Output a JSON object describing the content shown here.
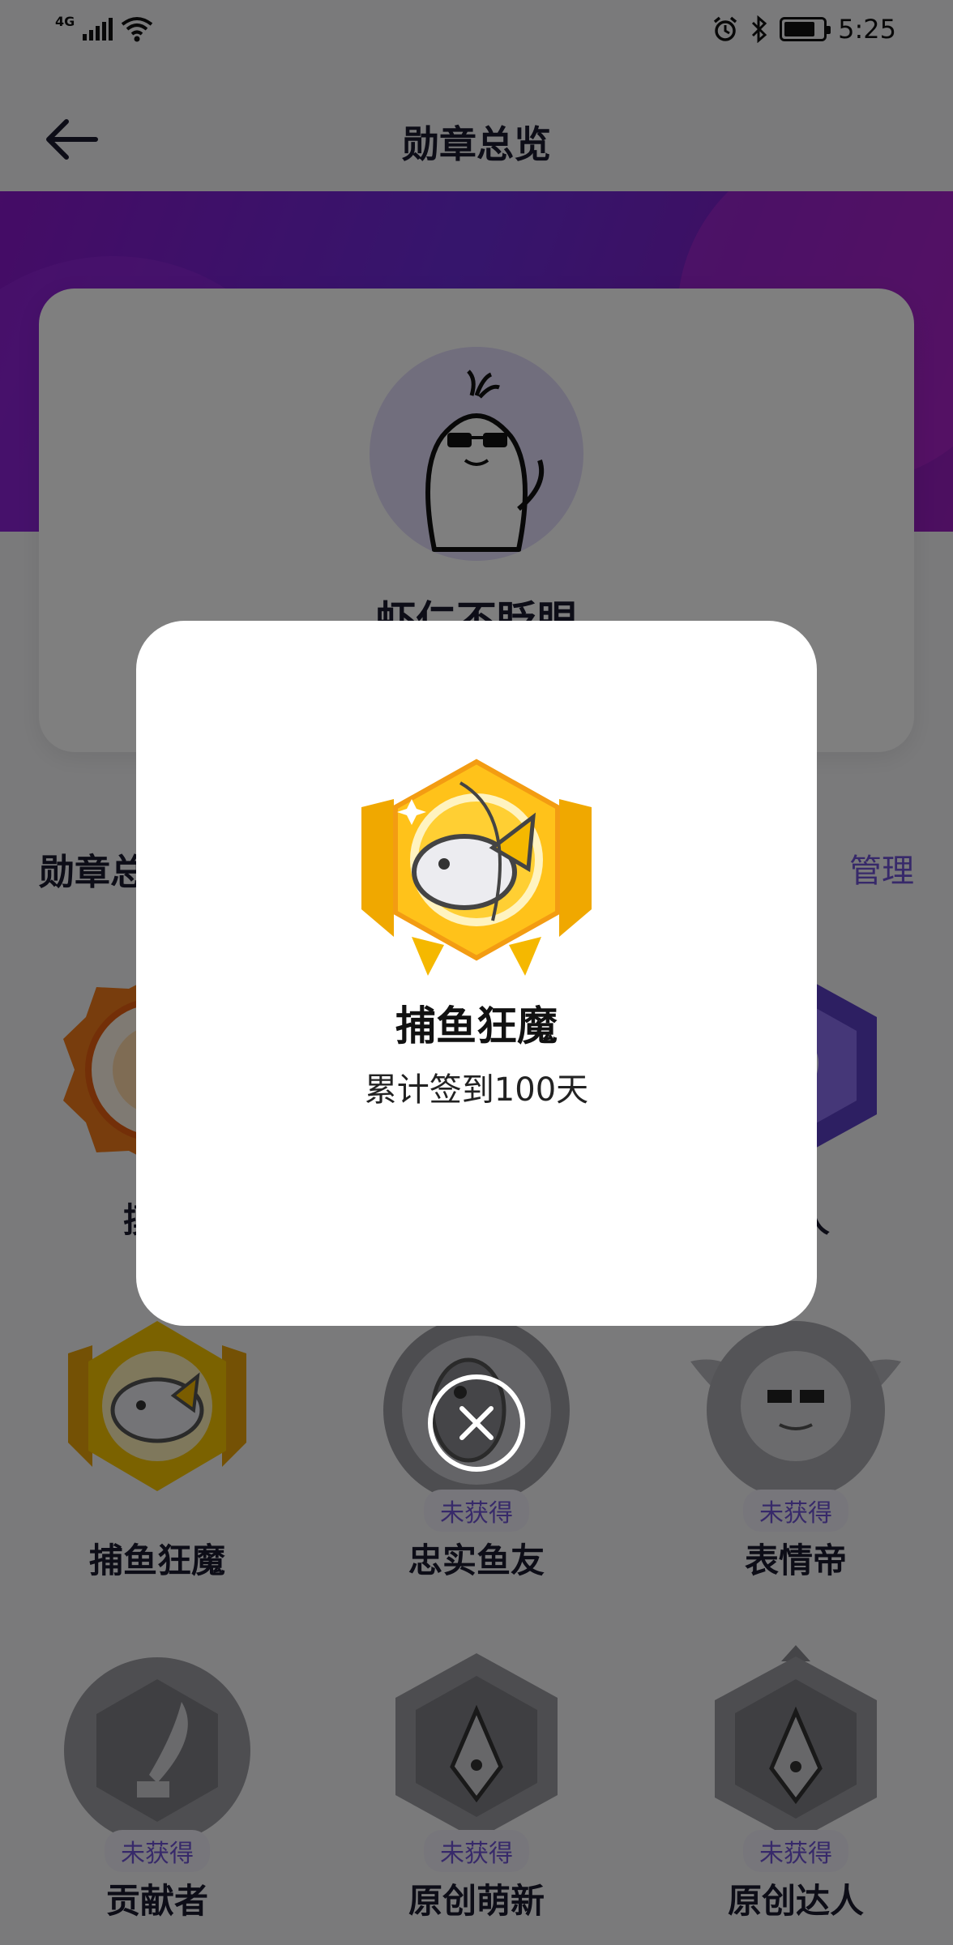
{
  "status_bar": {
    "network": "4G",
    "time": "5:25",
    "icons": [
      "signal-icon",
      "wifi-icon",
      "alarm-icon",
      "bluetooth-icon",
      "battery-icon"
    ]
  },
  "header": {
    "title": "勋章总览",
    "back_icon": "arrow-left-icon"
  },
  "profile": {
    "username": "虾仁不眨眼"
  },
  "section": {
    "title": "勋章总览",
    "manage_label": "管理"
  },
  "badges": [
    {
      "name": "摸鱼",
      "earned": true
    },
    {
      "name": "",
      "earned": true
    },
    {
      "name": "达人",
      "earned": true
    },
    {
      "name": "捕鱼狂魔",
      "earned": true
    },
    {
      "name": "忠实鱼友",
      "earned": false,
      "status": "未获得"
    },
    {
      "name": "表情帝",
      "earned": false,
      "status": "未获得"
    },
    {
      "name": "贡献者",
      "earned": false,
      "status": "未获得"
    },
    {
      "name": "原创萌新",
      "earned": false,
      "status": "未获得"
    },
    {
      "name": "原创达人",
      "earned": false,
      "status": "未获得"
    }
  ],
  "dialog": {
    "title": "捕鱼狂魔",
    "description": "累计签到100天",
    "close_icon": "close-icon"
  },
  "colors": {
    "banner": "#7a20c8",
    "accent": "#6f52d4",
    "gold": "#f5b800"
  }
}
